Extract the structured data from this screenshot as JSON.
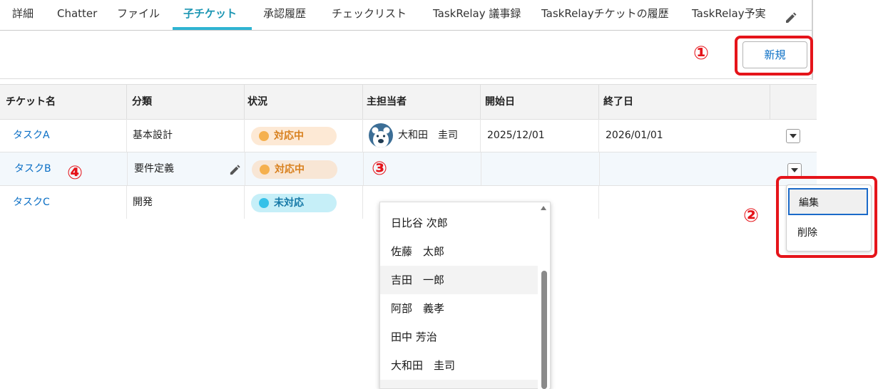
{
  "tabs": [
    {
      "label": "詳細"
    },
    {
      "label": "Chatter"
    },
    {
      "label": "ファイル"
    },
    {
      "label": "子チケット"
    },
    {
      "label": "承認履歴"
    },
    {
      "label": "チェックリスト"
    },
    {
      "label": "TaskRelay 議事録"
    },
    {
      "label": "TaskRelayチケットの履歴"
    },
    {
      "label": "TaskRelay予実"
    }
  ],
  "active_tab": "子チケット",
  "toolbar": {
    "new_label": "新規"
  },
  "table": {
    "columns": [
      "チケット名",
      "分類",
      "状況",
      "主担当者",
      "開始日",
      "終了日"
    ],
    "rows": [
      {
        "name": "タスクA",
        "category": "基本設計",
        "status": "対応中",
        "owner": "大和田　圭司",
        "start": "2025/12/01",
        "end": "2026/01/01"
      },
      {
        "name": "タスクB",
        "category": "要件定義",
        "status": "対応中",
        "owner": "",
        "start": "",
        "end": ""
      },
      {
        "name": "タスクC",
        "category": "開発",
        "status": "未対応",
        "owner": "",
        "start": "",
        "end": ""
      }
    ]
  },
  "row_menu": {
    "items": [
      "編集",
      "削除"
    ]
  },
  "owner_dropdown": {
    "options": [
      "日比谷 次郎",
      "佐藤　太郎",
      "吉田　一郎",
      "阿部　義孝",
      "田中 芳治",
      "大和田　圭司"
    ]
  },
  "annotations": {
    "m1": "①",
    "m2": "②",
    "m3": "③",
    "m4": "④"
  },
  "colors": {
    "accent": "#1b96b3",
    "link": "#0b6fc5",
    "status_in_progress_bg": "#fde9d5",
    "status_in_progress_dot": "#f5b04e",
    "status_in_progress_text": "#d8801e",
    "status_open_bg": "#c6eff8",
    "status_open_dot": "#36c1e8",
    "status_open_text": "#1679a7",
    "annotation_red": "#e5141a"
  },
  "icons": {
    "edit": "pencil-icon",
    "row_action": "chevron-down-icon",
    "avatar": "bear-avatar-icon"
  }
}
